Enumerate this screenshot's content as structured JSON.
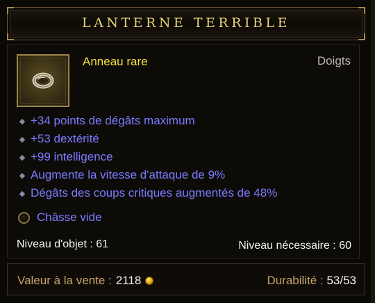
{
  "item": {
    "name": "LANTERNE TERRIBLE",
    "type": "Anneau rare",
    "slot": "Doigts",
    "icon": "ring-icon"
  },
  "affixes": [
    "+34 points de dégâts maximum",
    "+53 dextérité",
    "+99 intelligence",
    "Augmente la vitesse d'attaque de 9%",
    "Dégâts des coups critiques augmentés de 48%"
  ],
  "socket": {
    "label": "Châsse vide",
    "icon": "empty-socket-icon"
  },
  "levels": {
    "item_level": "Niveau d'objet : 61",
    "required_level": "Niveau nécessaire : 60"
  },
  "footer": {
    "sell_label": "Valeur à la vente :",
    "sell_value": "2118",
    "durability_label": "Durabilité :",
    "durability_value": "53/53"
  },
  "colors": {
    "title": "#e8d27a",
    "rare": "#f3e23a",
    "magic": "#7d7bff",
    "white": "#f1f1ee",
    "gold_label": "#c9a26a"
  }
}
